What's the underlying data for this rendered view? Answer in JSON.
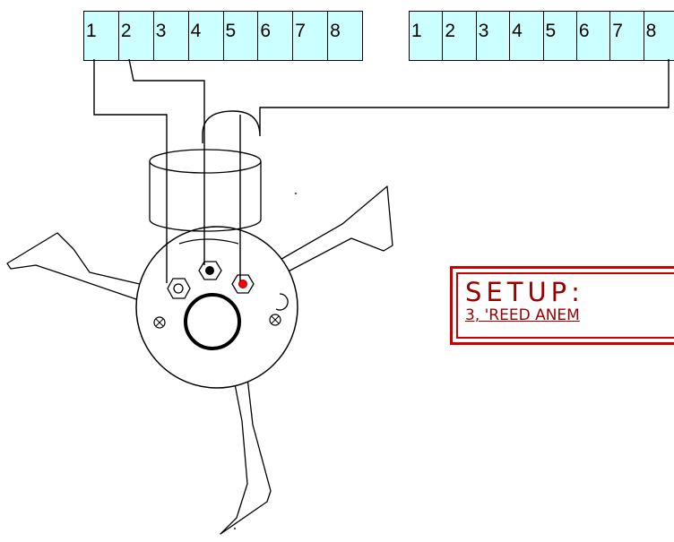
{
  "terminal_strips": [
    {
      "labels": [
        "1",
        "2",
        "3",
        "4",
        "5",
        "6",
        "7",
        "8"
      ]
    },
    {
      "labels": [
        "1",
        "2",
        "3",
        "4",
        "5",
        "6",
        "7",
        "8"
      ]
    }
  ],
  "setup": {
    "title": "SETUP:",
    "subtitle": "3, 'REED ANEM"
  },
  "colors": {
    "terminal_fill": "#ccffff",
    "setup_border": "#cc0000",
    "setup_text": "#990000",
    "red_terminal": "#ff0000"
  }
}
